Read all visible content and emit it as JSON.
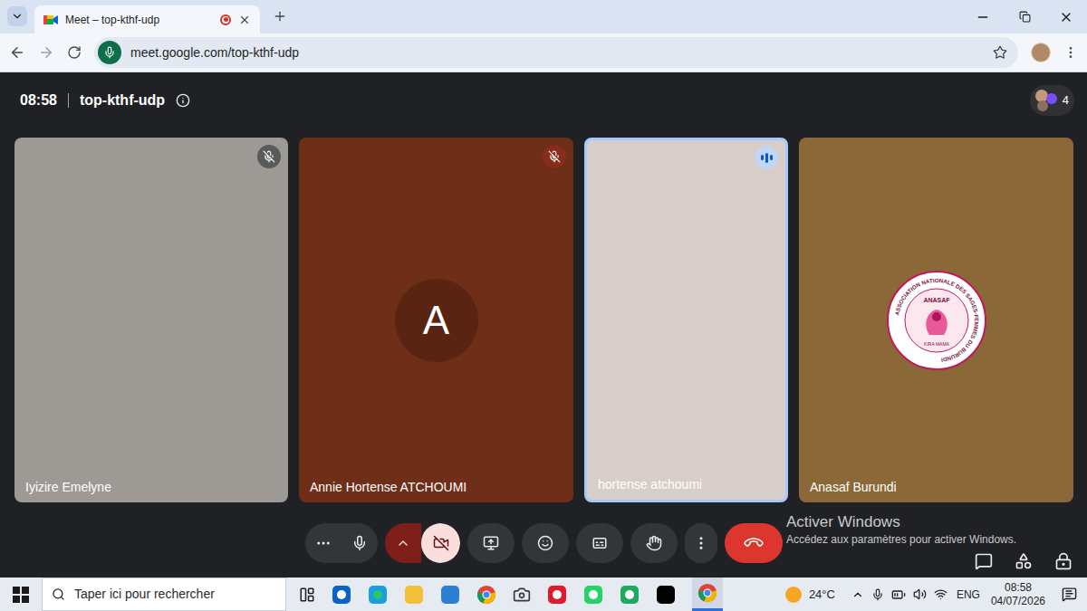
{
  "browser": {
    "tab_title": "Meet – top-kthf-udp",
    "recording": true,
    "url": "meet.google.com/top-kthf-udp"
  },
  "meeting": {
    "time": "08:58",
    "code": "top-kthf-udp",
    "participant_count": "4"
  },
  "participants": [
    {
      "name": "Iyizire Emelyne",
      "kind": "video",
      "muted": true,
      "speaking": false
    },
    {
      "name": "Annie Hortense ATCHOUMI",
      "kind": "avatar",
      "initial": "A",
      "muted": true,
      "speaking": false
    },
    {
      "name": "hortense atchoumi",
      "kind": "video",
      "muted": false,
      "speaking": true
    },
    {
      "name": "Anasaf Burundi",
      "kind": "logo",
      "muted": false,
      "speaking": false,
      "logo": {
        "title": "ANASAF",
        "ring": "ASSOCIATION NATIONALE DES SAGES-FEMMES DU BURUNDI",
        "motto": "KIRA MAMA"
      }
    }
  ],
  "controls": {
    "mic_on": true,
    "camera_on": false
  },
  "watermark": {
    "title": "Activer Windows",
    "subtitle": "Accédez aux paramètres pour activer Windows."
  },
  "taskbar": {
    "search_placeholder": "Taper ici pour rechercher",
    "weather": "24°C",
    "language": "ENG",
    "time": "08:58",
    "date": "04/07/2026"
  }
}
